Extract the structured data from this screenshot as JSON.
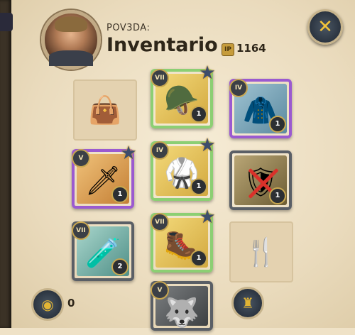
{
  "header": {
    "username": "POV3DA:",
    "title": "Inventario",
    "ip_label": "IP",
    "ip_value": "1164"
  },
  "buttons": {
    "close_icon": "close-icon",
    "close_glyph": "✕",
    "gold_icon": "gold-coin-icon",
    "gold_glyph": "◉",
    "gold_count": "0",
    "equip_icon": "equipment-stats-icon",
    "equip_glyph": "♜"
  },
  "slots": [
    {
      "name": "bag",
      "empty": true,
      "glyph": "👜"
    },
    {
      "name": "head",
      "tier": "VII",
      "qty": "1",
      "art": "🪖"
    },
    {
      "name": "cape",
      "tier": "IV",
      "qty": "1",
      "art": "🧥"
    },
    {
      "name": "main-hand",
      "tier": "V",
      "qty": "1",
      "art": "🗡"
    },
    {
      "name": "armor",
      "tier": "IV",
      "qty": "1",
      "art": "🥋"
    },
    {
      "name": "off-hand",
      "tier": "",
      "qty": "1",
      "art": "🛡"
    },
    {
      "name": "potion",
      "tier": "VII",
      "qty": "2",
      "art": "🧪"
    },
    {
      "name": "shoes",
      "tier": "VII",
      "qty": "1",
      "art": "🥾"
    },
    {
      "name": "food",
      "empty": true,
      "glyph": "🍴"
    },
    {
      "name": "mount",
      "tier": "V",
      "qty": "",
      "art": "🐺"
    }
  ],
  "colors": {
    "gold_quality": "#d3a93f",
    "green_quality": "#8ccf73",
    "purple_quality": "#9b5ad0"
  }
}
